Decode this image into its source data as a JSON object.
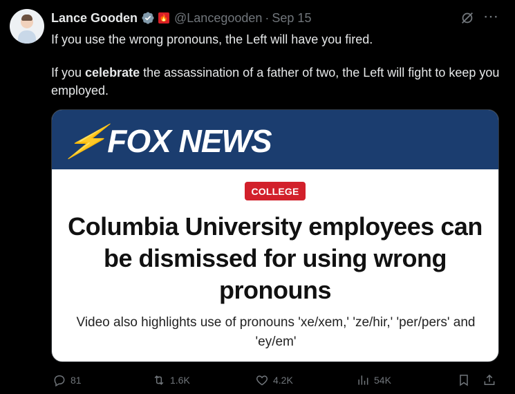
{
  "author": {
    "name": "Lance Gooden",
    "handle": "@Lancegooden",
    "separator": "·",
    "date": "Sep 15",
    "flag_glyph": "🔥"
  },
  "tweet": {
    "line1": "If you use the wrong pronouns, the Left will have you fired.",
    "line2_pre": "If you ",
    "line2_bold": "celebrate",
    "line2_post": " the assassination of a father of two, the Left will fight to keep you employed."
  },
  "card": {
    "brand": "FOX NEWS",
    "category": "COLLEGE",
    "headline": "Columbia University employees can be dismissed for using wrong pronouns",
    "subhead": "Video also highlights use of pronouns 'xe/xem,' 'ze/hir,' 'per/pers' and 'ey/em'",
    "band_color": "#1b3d6f",
    "badge_color": "#d2202b"
  },
  "actions": {
    "replies": "81",
    "reposts": "1.6K",
    "likes": "4.2K",
    "views": "54K"
  },
  "icons": [
    "verified-badge-icon",
    "flag-icon",
    "grok-icon",
    "more-icon",
    "reply-icon",
    "repost-icon",
    "like-icon",
    "views-icon",
    "bookmark-icon",
    "share-icon"
  ]
}
